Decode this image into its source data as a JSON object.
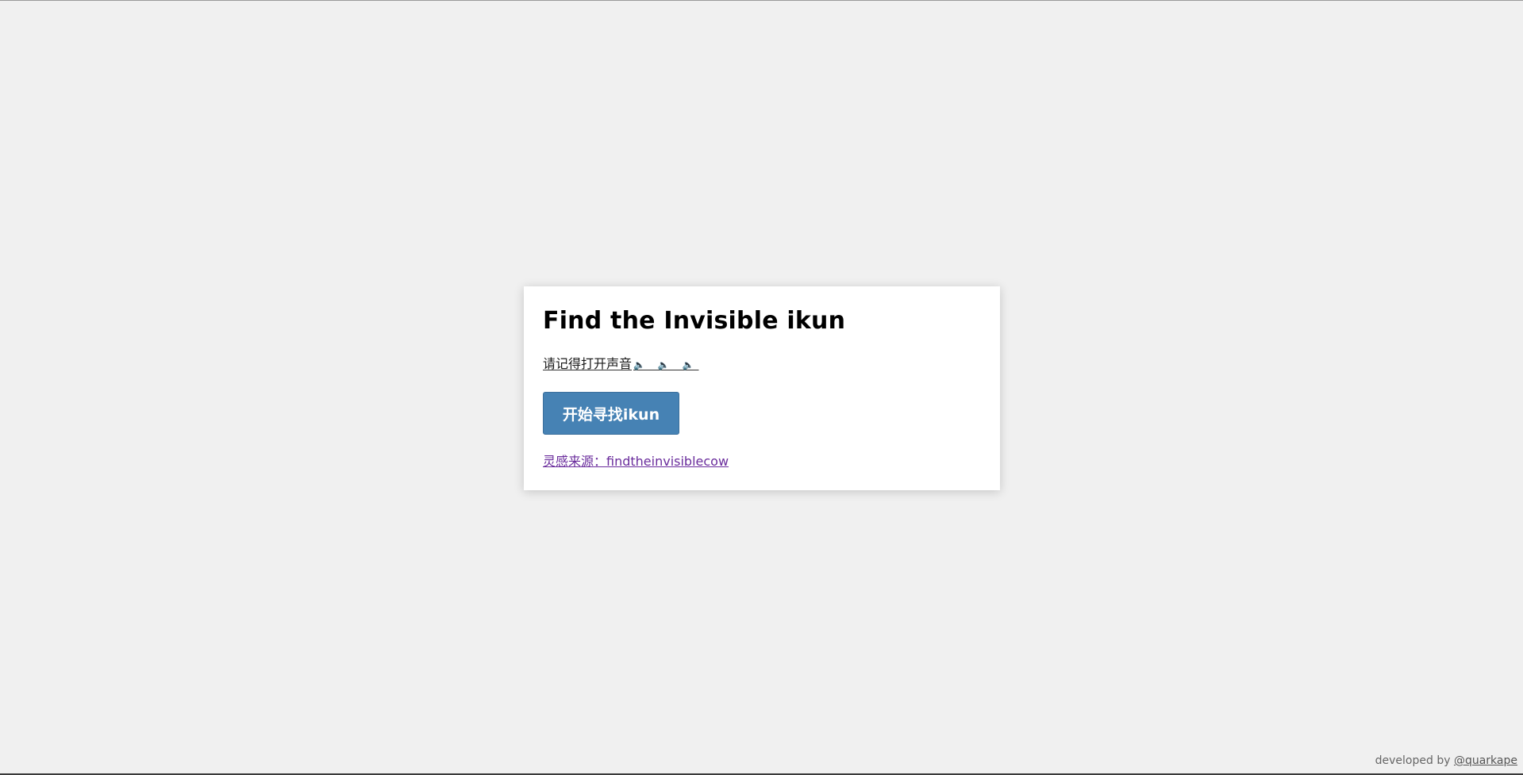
{
  "card": {
    "title": "Find the Invisible ikun",
    "sound_hint": "请记得打开声音",
    "speaker_icons": "🔈 🔈 🔈",
    "start_button_label": "开始寻找ikun",
    "inspiration_link": "灵感来源：findtheinvisiblecow"
  },
  "footer": {
    "prefix": "developed by",
    "author_link": "@quarkape"
  },
  "colors": {
    "background": "#f0f0f0",
    "card": "#ffffff",
    "button": "#4682b4",
    "visited_link": "#6a2c9c"
  }
}
